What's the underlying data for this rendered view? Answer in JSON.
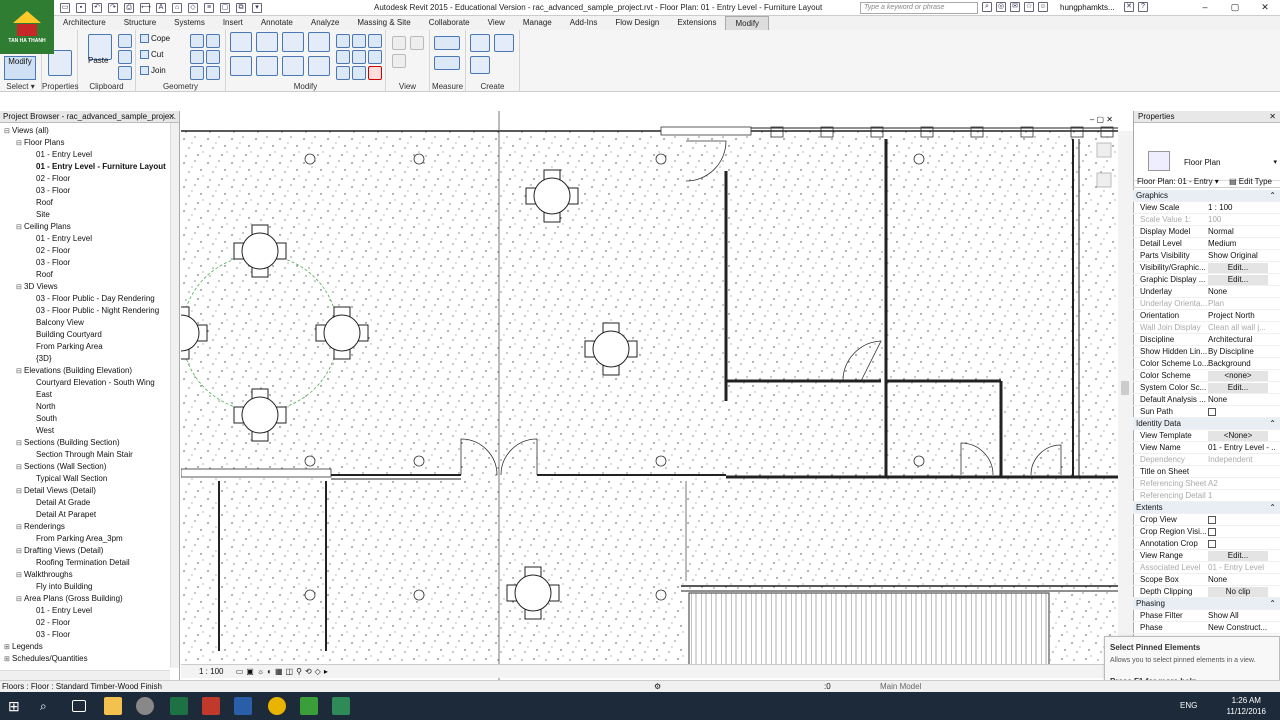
{
  "logo_text": "TAN HA THANH",
  "title": "Autodesk Revit 2015 - Educational Version -    rac_advanced_sample_project.rvt - Floor Plan: 01 - Entry Level - Furniture Layout",
  "search_placeholder": "Type a keyword or phrase",
  "user": "hungphamkts...",
  "tabs": [
    "Architecture",
    "Structure",
    "Systems",
    "Insert",
    "Annotate",
    "Analyze",
    "Massing & Site",
    "Collaborate",
    "View",
    "Manage",
    "Add-Ins",
    "Flow Design",
    "Extensions",
    "Modify"
  ],
  "active_tab": "Modify",
  "ribbon": {
    "modify": "Modify",
    "select": "Select ▾",
    "properties": "Properties",
    "paste": "Paste",
    "cope": "Cope",
    "cut": "Cut",
    "join": "Join",
    "panels": [
      "Clipboard",
      "Geometry",
      "Modify",
      "View",
      "Measure",
      "Create"
    ]
  },
  "browser": {
    "title": "Project Browser - rac_advanced_sample_proje...",
    "items": [
      {
        "t": "Views (all)",
        "l": 0,
        "tg": "⊟"
      },
      {
        "t": "Floor Plans",
        "l": 1,
        "tg": "⊟"
      },
      {
        "t": "01 - Entry Level",
        "l": 2
      },
      {
        "t": "01 - Entry Level - Furniture Layout",
        "l": 2,
        "sel": true
      },
      {
        "t": "02 - Floor",
        "l": 2
      },
      {
        "t": "03 - Floor",
        "l": 2
      },
      {
        "t": "Roof",
        "l": 2
      },
      {
        "t": "Site",
        "l": 2
      },
      {
        "t": "Ceiling Plans",
        "l": 1,
        "tg": "⊟"
      },
      {
        "t": "01 - Entry Level",
        "l": 2
      },
      {
        "t": "02 - Floor",
        "l": 2
      },
      {
        "t": "03 - Floor",
        "l": 2
      },
      {
        "t": "Roof",
        "l": 2
      },
      {
        "t": "3D Views",
        "l": 1,
        "tg": "⊟"
      },
      {
        "t": "03 - Floor Public - Day Rendering",
        "l": 2
      },
      {
        "t": "03 - Floor Public - Night Rendering",
        "l": 2
      },
      {
        "t": "Balcony View",
        "l": 2
      },
      {
        "t": "Building Courtyard",
        "l": 2
      },
      {
        "t": "From Parking Area",
        "l": 2
      },
      {
        "t": "{3D}",
        "l": 2
      },
      {
        "t": "Elevations (Building Elevation)",
        "l": 1,
        "tg": "⊟"
      },
      {
        "t": "Courtyard Elevation - South Wing",
        "l": 2
      },
      {
        "t": "East",
        "l": 2
      },
      {
        "t": "North",
        "l": 2
      },
      {
        "t": "South",
        "l": 2
      },
      {
        "t": "West",
        "l": 2
      },
      {
        "t": "Sections (Building Section)",
        "l": 1,
        "tg": "⊟"
      },
      {
        "t": "Section Through Main Stair",
        "l": 2
      },
      {
        "t": "Sections (Wall Section)",
        "l": 1,
        "tg": "⊟"
      },
      {
        "t": "Typical Wall Section",
        "l": 2
      },
      {
        "t": "Detail Views (Detail)",
        "l": 1,
        "tg": "⊟"
      },
      {
        "t": "Detail At Grade",
        "l": 2
      },
      {
        "t": "Detail At Parapet",
        "l": 2
      },
      {
        "t": "Renderings",
        "l": 1,
        "tg": "⊟"
      },
      {
        "t": "From Parking Area_3pm",
        "l": 2
      },
      {
        "t": "Drafting Views (Detail)",
        "l": 1,
        "tg": "⊟"
      },
      {
        "t": "Roofing Termination Detail",
        "l": 2
      },
      {
        "t": "Walkthroughs",
        "l": 1,
        "tg": "⊟"
      },
      {
        "t": "Fly into Building",
        "l": 2
      },
      {
        "t": "Area Plans (Gross Building)",
        "l": 1,
        "tg": "⊟"
      },
      {
        "t": "01 - Entry Level",
        "l": 2
      },
      {
        "t": "02 - Floor",
        "l": 2
      },
      {
        "t": "03 - Floor",
        "l": 2
      },
      {
        "t": "Legends",
        "l": 0,
        "tg": "⊞"
      },
      {
        "t": "Schedules/Quantities",
        "l": 0,
        "tg": "⊞"
      }
    ]
  },
  "viewbar_scale": "1 : 100",
  "properties": {
    "title": "Properties",
    "type": "Floor Plan",
    "selector": "Floor Plan: 01 - Entry ▾",
    "edit_type": "Edit Type",
    "rows": [
      {
        "k": "Graphics",
        "sec": true
      },
      {
        "k": "View Scale",
        "v": "1 : 100"
      },
      {
        "k": "Scale Value    1:",
        "v": "100",
        "dim": true
      },
      {
        "k": "Display Model",
        "v": "Normal"
      },
      {
        "k": "Detail Level",
        "v": "Medium"
      },
      {
        "k": "Parts Visibility",
        "v": "Show Original"
      },
      {
        "k": "Visibility/Graphic...",
        "v": "Edit...",
        "btn": true
      },
      {
        "k": "Graphic Display ...",
        "v": "Edit...",
        "btn": true
      },
      {
        "k": "Underlay",
        "v": "None"
      },
      {
        "k": "Underlay Orienta...",
        "v": "Plan",
        "dim": true
      },
      {
        "k": "Orientation",
        "v": "Project North"
      },
      {
        "k": "Wall Join Display",
        "v": "Clean all wall j...",
        "dim": true
      },
      {
        "k": "Discipline",
        "v": "Architectural"
      },
      {
        "k": "Show Hidden Lin...",
        "v": "By Discipline"
      },
      {
        "k": "Color Scheme Lo...",
        "v": "Background"
      },
      {
        "k": "Color Scheme",
        "v": "<none>",
        "btn": true
      },
      {
        "k": "System Color Sc...",
        "v": "Edit...",
        "btn": true
      },
      {
        "k": "Default Analysis ...",
        "v": "None"
      },
      {
        "k": "Sun Path",
        "chk": true
      },
      {
        "k": "Identity Data",
        "sec": true
      },
      {
        "k": "View Template",
        "v": "<None>",
        "btn": true
      },
      {
        "k": "View Name",
        "v": "01 - Entry Level - ..."
      },
      {
        "k": "Dependency",
        "v": "Independent",
        "dim": true
      },
      {
        "k": "Title on Sheet",
        "v": ""
      },
      {
        "k": "Referencing Sheet",
        "v": "A2",
        "dim": true
      },
      {
        "k": "Referencing Detail",
        "v": "1",
        "dim": true
      },
      {
        "k": "Extents",
        "sec": true
      },
      {
        "k": "Crop View",
        "chk": true
      },
      {
        "k": "Crop Region Visi...",
        "chk": true
      },
      {
        "k": "Annotation Crop",
        "chk": true
      },
      {
        "k": "View Range",
        "v": "Edit...",
        "btn": true
      },
      {
        "k": "Associated Level",
        "v": "01 - Entry Level",
        "dim": true
      },
      {
        "k": "Scope Box",
        "v": "None"
      },
      {
        "k": "Depth Clipping",
        "v": "No clip",
        "btn": true
      },
      {
        "k": "Phasing",
        "sec": true
      },
      {
        "k": "Phase Filter",
        "v": "Show All"
      },
      {
        "k": "Phase",
        "v": "New Construct..."
      }
    ]
  },
  "tooltip": {
    "title": "Select Pinned Elements",
    "desc": "Allows you to select pinned elements in a view.",
    "help": "Press F1 for more help"
  },
  "status": {
    "text": "Floors : Floor : Standard Timber-Wood Finish",
    "zero": ":0",
    "model": "Main Model"
  },
  "clock": {
    "time": "1:26 AM",
    "date": "11/12/2016"
  },
  "lang": "ENG"
}
